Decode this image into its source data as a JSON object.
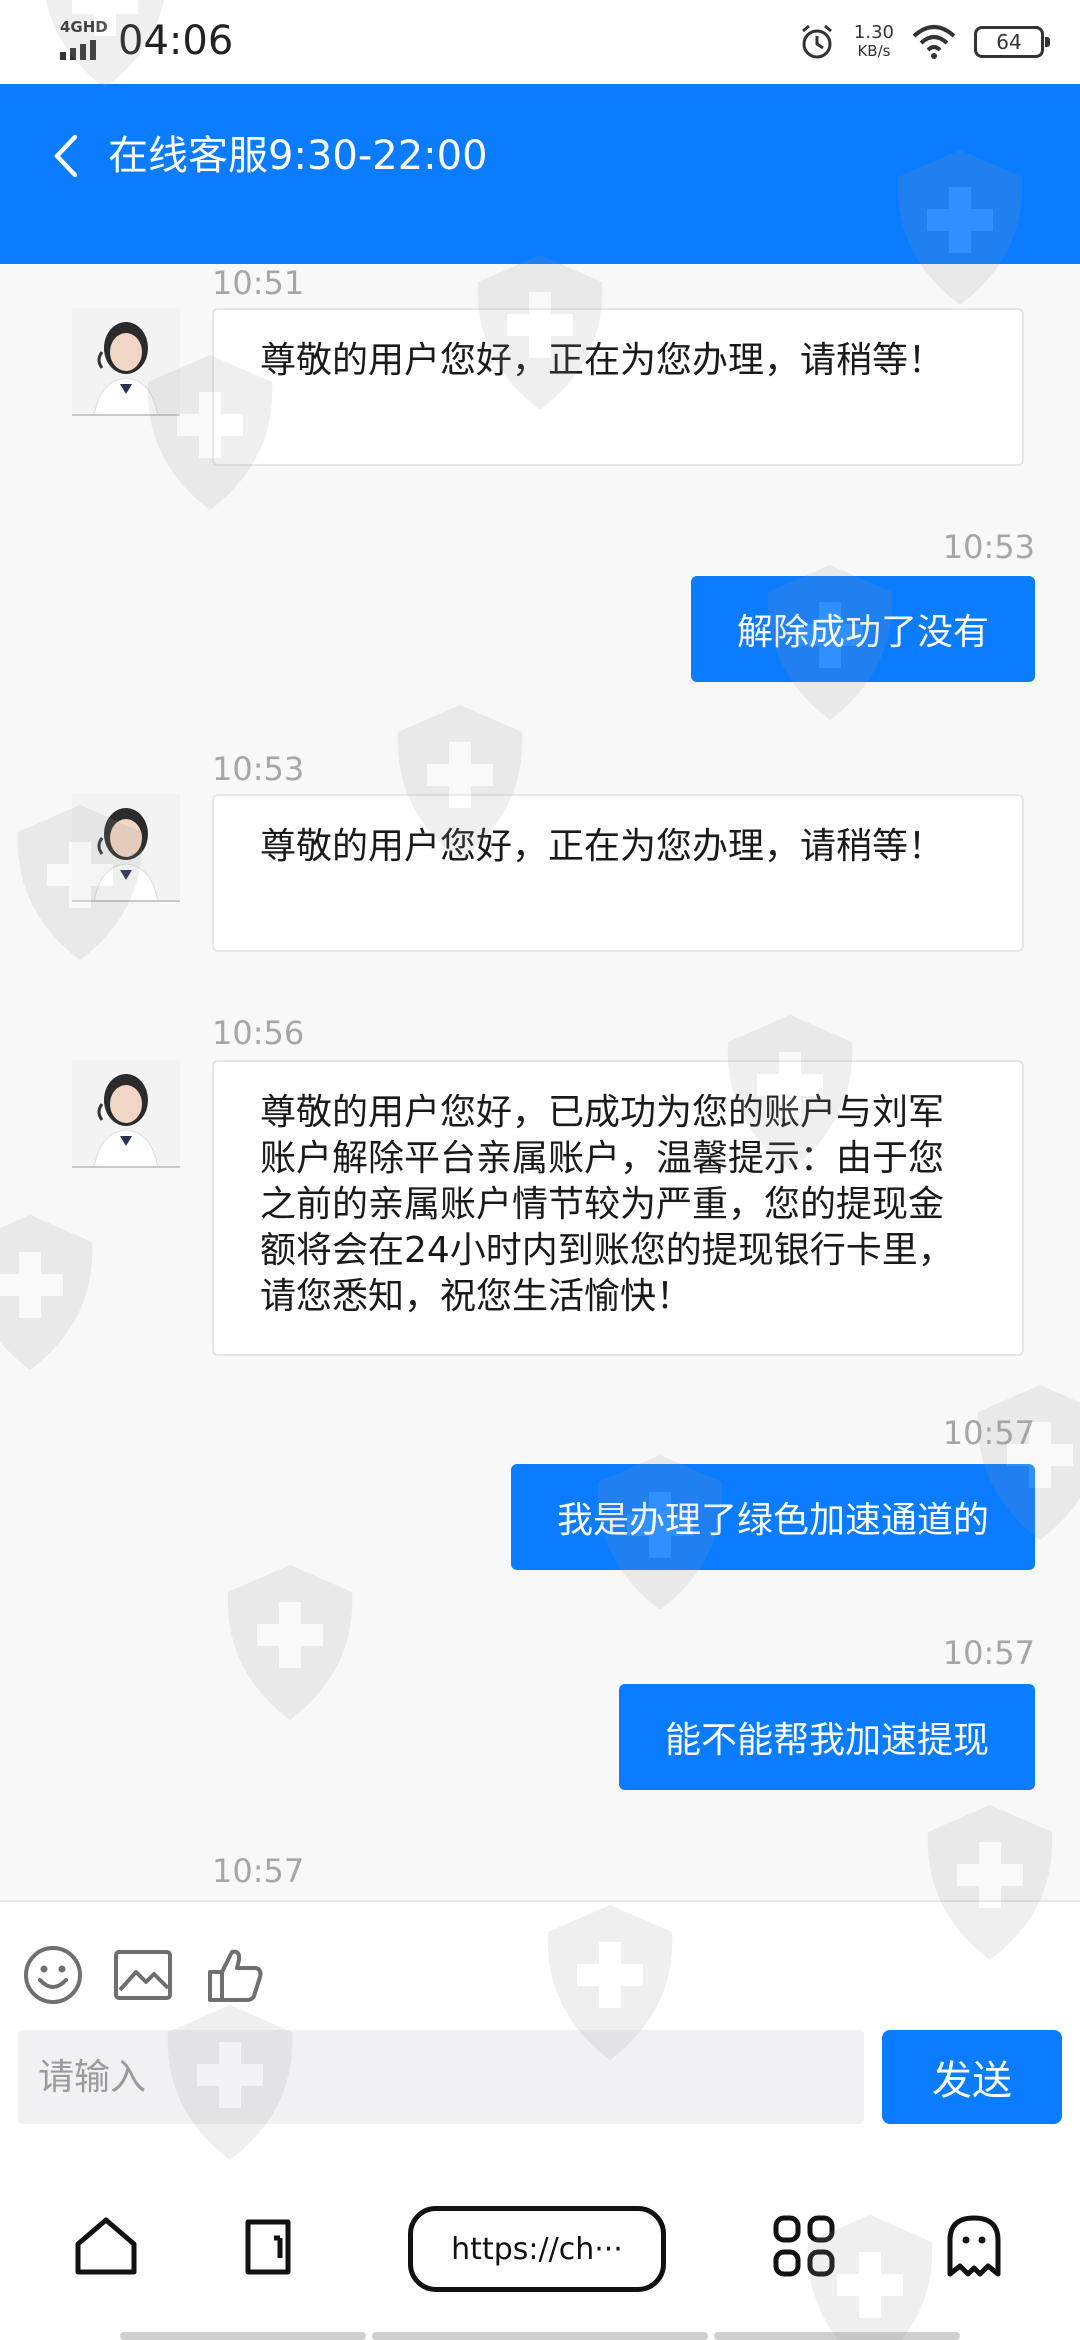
{
  "status_bar": {
    "network": "4GHD",
    "time": "04:06",
    "speed_value": "1.30",
    "speed_unit": "KB/s",
    "battery": "64"
  },
  "header": {
    "title": "在线客服9:30-22:00"
  },
  "messages": [
    {
      "side": "in",
      "time": "10:51",
      "text": "尊敬的用户您好，正在为您办理，请稍等！"
    },
    {
      "side": "out",
      "time": "10:53",
      "text": "解除成功了没有"
    },
    {
      "side": "in",
      "time": "10:53",
      "text": "尊敬的用户您好，正在为您办理，请稍等！"
    },
    {
      "side": "in",
      "time": "10:56",
      "text": "尊敬的用户您好，已成功为您的账户与刘军账户解除平台亲属账户，温馨提示：由于您之前的亲属账户情节较为严重，您的提现金额将会在24小时内到账您的提现银行卡里，请您悉知，祝您生活愉快！"
    },
    {
      "side": "out",
      "time": "10:57",
      "text": "我是办理了绿色加速通道的"
    },
    {
      "side": "out",
      "time": "10:57",
      "text": "能不能帮我加速提现"
    },
    {
      "side": "in",
      "time": "10:57",
      "text": ""
    }
  ],
  "composer": {
    "placeholder": "请输入",
    "send_label": "发送"
  },
  "browser": {
    "url": "https://ch···"
  },
  "colors": {
    "accent": "#0a7cff",
    "background": "#f8f8f8"
  }
}
